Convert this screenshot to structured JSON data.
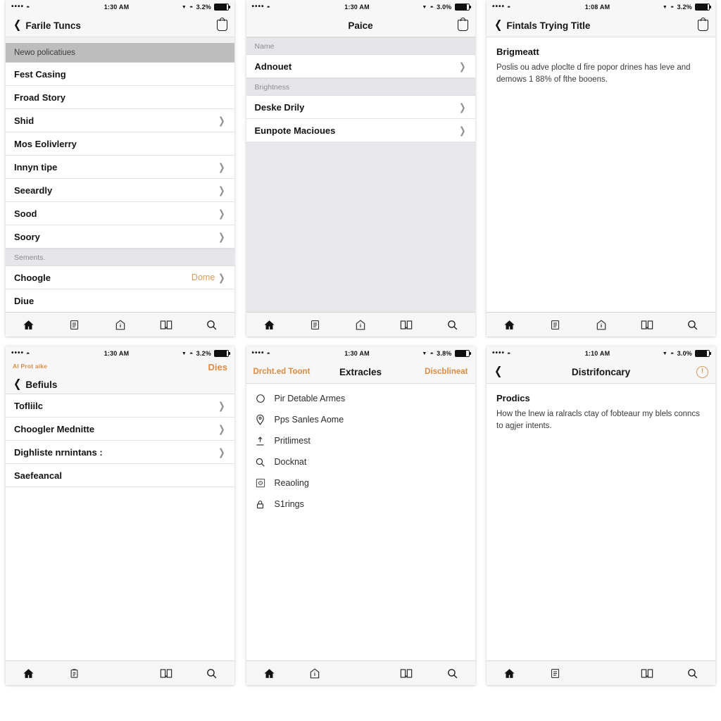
{
  "meta": {
    "accent_orange": "#dd8a44",
    "accent_value": "#dd9a52",
    "section_header_dark": "#bdbdbd",
    "section_header_light": "#e6e6ea",
    "nav_bg": "#f7f7f7",
    "tabbar_bg": "#f6f6f6"
  },
  "status_bar": {
    "signal_dots": "••••",
    "wifi": "wifi-icon",
    "times": [
      "1:30 AM",
      "1:30 AM",
      "1:08 AM",
      "1:30 AM",
      "1:30 AM",
      "1:10 AM"
    ],
    "batteries": [
      "3.2%",
      "3.0%",
      "3.2%",
      "3.2%",
      "3.8%",
      "3.0%"
    ],
    "dropdown_glyph": "▼"
  },
  "tab_bar": {
    "items": [
      {
        "name": "home-tab",
        "icon": "home-icon",
        "active": true
      },
      {
        "name": "list-tab",
        "icon": "document-icon",
        "active": false
      },
      {
        "name": "info-tab",
        "icon": "info-house-icon",
        "active": false
      },
      {
        "name": "book-tab",
        "icon": "book-icon",
        "active": false
      },
      {
        "name": "search-tab",
        "icon": "search-icon",
        "active": false
      }
    ]
  },
  "screens": [
    {
      "id": "screen-1",
      "nav": {
        "back": true,
        "title": "Farile Tuncs",
        "right_icon": "bag-icon"
      },
      "sections": [
        {
          "header": "Newo policatiues",
          "header_style": "dark",
          "rows": [
            {
              "label": "Fest Casing",
              "chevron": false,
              "value": ""
            },
            {
              "label": "Froad Story",
              "chevron": false,
              "value": ""
            },
            {
              "label": "Shid",
              "chevron": true,
              "value": ""
            },
            {
              "label": "Mos Eolivlerry",
              "chevron": false,
              "value": ""
            },
            {
              "label": "Innyn tipe",
              "chevron": true,
              "value": ""
            },
            {
              "label": "Seeardly",
              "chevron": true,
              "value": ""
            },
            {
              "label": "Sood",
              "chevron": true,
              "value": ""
            },
            {
              "label": "Soory",
              "chevron": true,
              "value": ""
            }
          ]
        },
        {
          "header": "Sements.",
          "header_style": "light",
          "rows": [
            {
              "label": "Choogle",
              "chevron": true,
              "value": "Dome"
            },
            {
              "label": "Diue",
              "chevron": false,
              "value": ""
            }
          ]
        }
      ]
    },
    {
      "id": "screen-2",
      "nav": {
        "back": false,
        "title": "Paice",
        "right_icon": "bag-icon"
      },
      "sections": [
        {
          "header": "Name",
          "header_style": "light",
          "rows": [
            {
              "label": "Adnouet",
              "chevron": true,
              "value": ""
            }
          ]
        },
        {
          "header": "Brightness",
          "header_style": "light",
          "rows": [
            {
              "label": "Deske Drily",
              "chevron": true,
              "value": ""
            },
            {
              "label": "Eunpote Macioues",
              "chevron": true,
              "value": ""
            }
          ]
        }
      ]
    },
    {
      "id": "screen-3",
      "nav": {
        "back": true,
        "title": "Fintals Trying Title",
        "right_icon": "bag-icon"
      },
      "article": {
        "heading": "Brigmeatt",
        "body": "Poslis ou adve ploclte d fire popor drines has leve and demows 1 88% of fthe booens."
      }
    },
    {
      "id": "screen-4",
      "nav": {
        "prompt": "Al Prot aike",
        "action_right": "Dies",
        "back": true,
        "title": "Befiuls"
      },
      "sections": [
        {
          "header": "",
          "header_style": "none",
          "rows": [
            {
              "label": "Tofliilc",
              "chevron": true,
              "value": ""
            },
            {
              "label": "Choogler Mednitte",
              "chevron": true,
              "value": ""
            },
            {
              "label": "Dighliste nrnintans :",
              "chevron": true,
              "value": ""
            },
            {
              "label": "Saefeancal",
              "chevron": false,
              "value": ""
            }
          ]
        }
      ]
    },
    {
      "id": "screen-5",
      "nav": {
        "left_action": "Drcht.ed Toont",
        "title": "Extracles",
        "right_action": "Discblineat"
      },
      "icon_rows": [
        {
          "icon": "circle-icon",
          "label": "Pir Detable Armes"
        },
        {
          "icon": "map-pin-icon",
          "label": "Pps Sanles Aome"
        },
        {
          "icon": "upload-icon",
          "label": "Pritlimest"
        },
        {
          "icon": "search-icon",
          "label": "Docknat"
        },
        {
          "icon": "image-icon",
          "label": "Reaoling"
        },
        {
          "icon": "lock-icon",
          "label": "S1rings"
        }
      ]
    },
    {
      "id": "screen-6",
      "nav": {
        "back": true,
        "title": "Distrifoncary",
        "right_icon": "circle-info-icon"
      },
      "article": {
        "heading": "Prodics",
        "body": "How the lnew ia ralracls ctay of fobteaur my blels conncs to agjer intents."
      }
    }
  ]
}
